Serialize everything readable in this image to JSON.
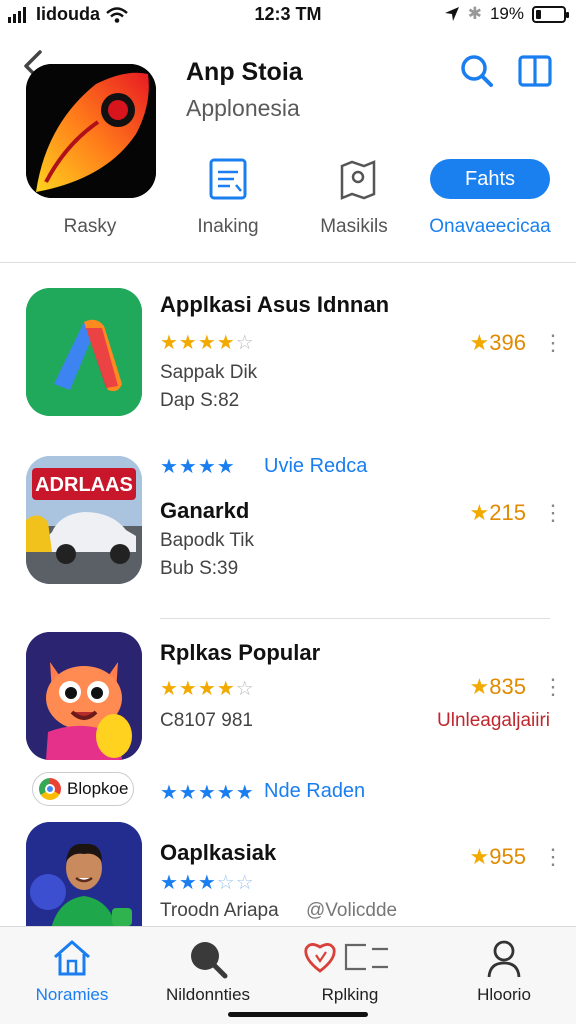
{
  "status_bar": {
    "carrier": "Iidouda",
    "time": "12:3 TM",
    "battery_pct": "19%",
    "battery_level": 0.19
  },
  "header": {
    "app_name": "Anp Stoia",
    "app_subtitle": "Applonesia"
  },
  "tabs": [
    {
      "label": "Rasky"
    },
    {
      "label": "Inaking"
    },
    {
      "label": "Masikils"
    },
    {
      "label": "Onavaeecicaa",
      "pill": "Fahts"
    }
  ],
  "items": [
    {
      "title": "Applkasi Asus Idnnan",
      "rating": "396",
      "stars": 4,
      "line1": "Sappak Dik",
      "line2": "Dap S:82"
    },
    {
      "title": "Ganarkd",
      "rating": "215",
      "stars": 4,
      "star_caption": "Uvie Redca",
      "line1": "Bapodk Tik",
      "line2": "Bub S:39",
      "icon_caption": "ADRLAAS"
    },
    {
      "title": "Rplkas Popular",
      "rating": "835",
      "stars": 4,
      "line1": "C8107 981",
      "line2": "Ulnleagaljaiiri"
    },
    {
      "title": "Oaplkasiak",
      "rating": "955",
      "stars": 3,
      "star_caption": "Nde Raden",
      "line1": "Troodn Ariapa",
      "line2": "@Volicdde",
      "chip": "Blopkoe"
    }
  ],
  "tab_bar": [
    {
      "label": "Noramies",
      "icon": "home-icon",
      "active": true
    },
    {
      "label": "Nildonnties",
      "icon": "search-icon"
    },
    {
      "label": "Rplking",
      "icon": "heart-icon"
    },
    {
      "label": "Hloorio",
      "icon": "person-icon"
    }
  ],
  "colors": {
    "accent": "#1a80f0",
    "star": "#f2a900",
    "rating_text": "#e08a00",
    "red_text": "#c0272d"
  }
}
